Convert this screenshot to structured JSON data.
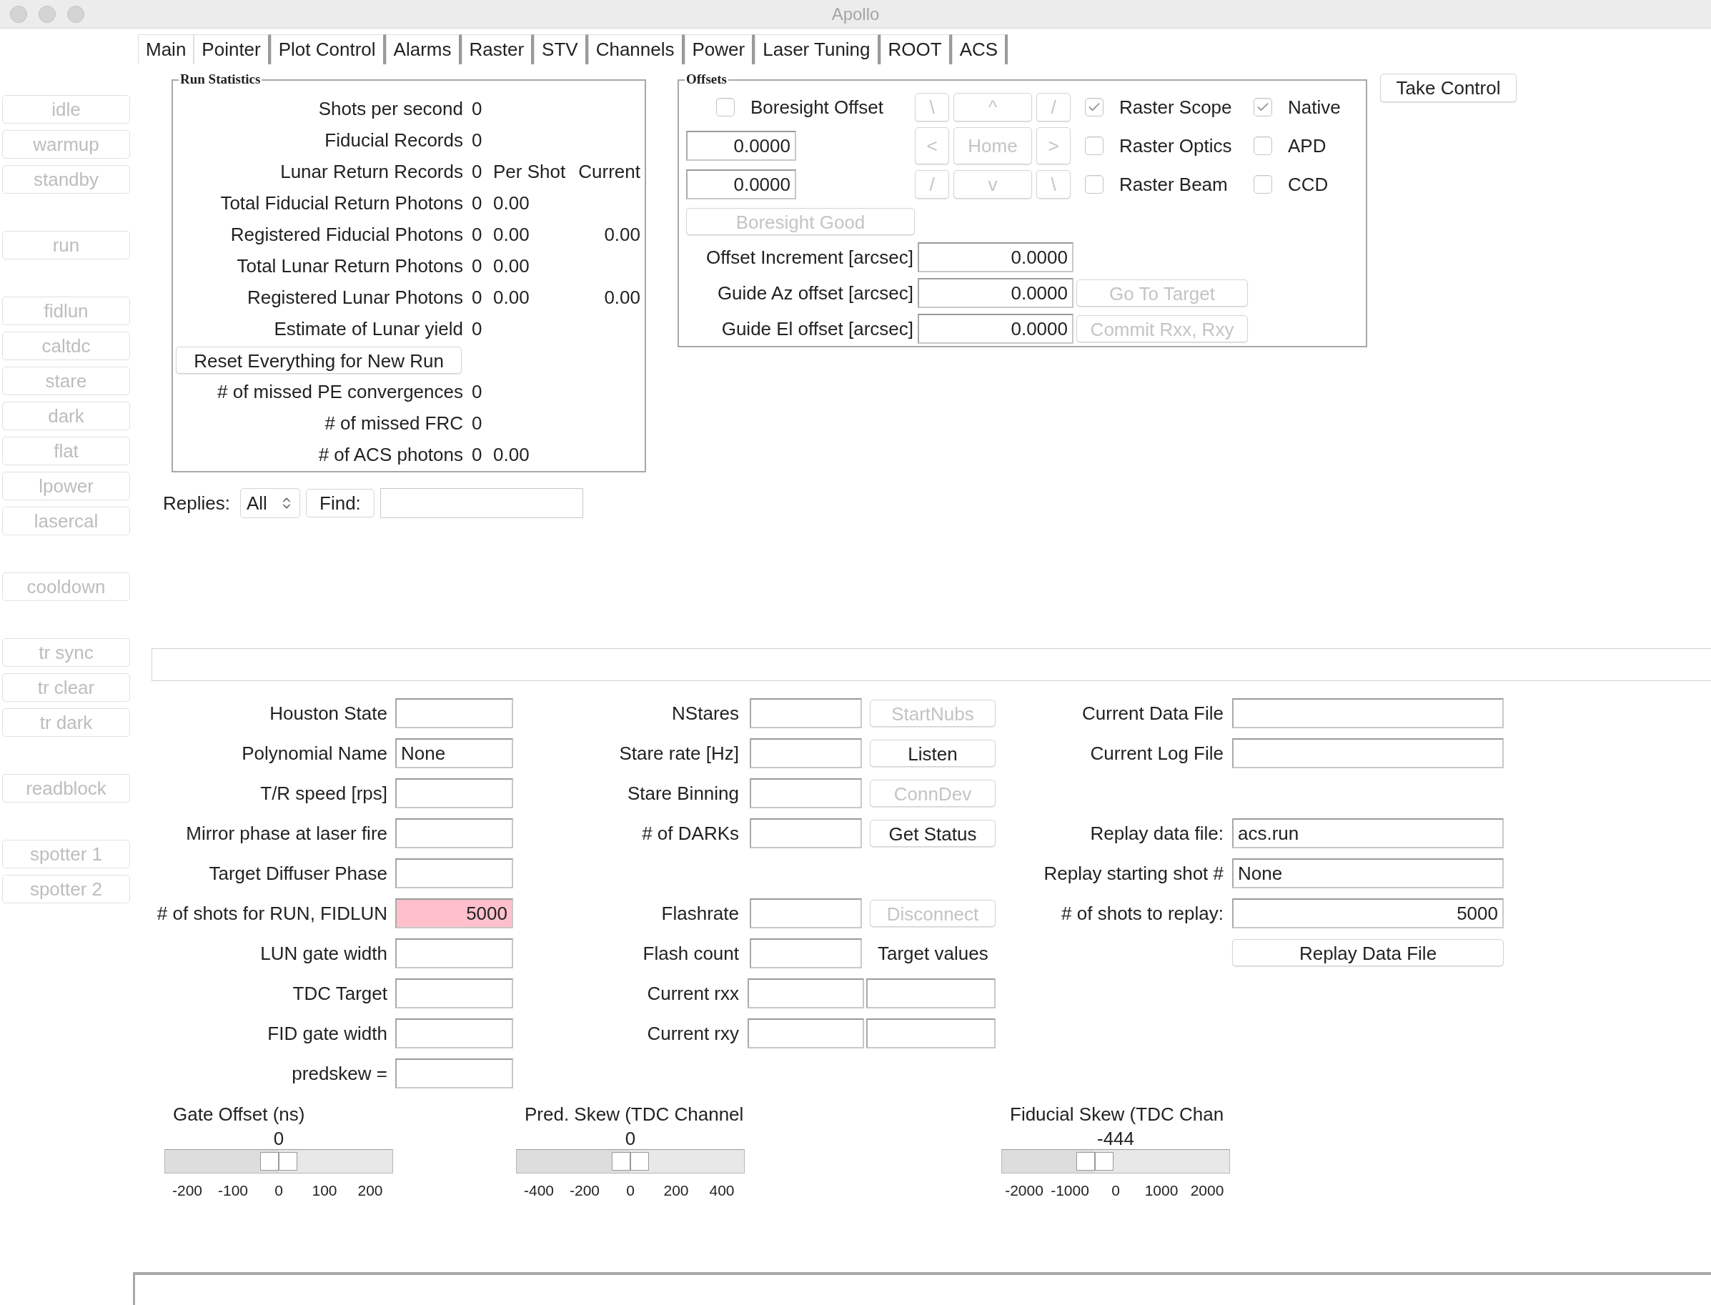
{
  "window": {
    "title": "Apollo"
  },
  "tabs": [
    {
      "label": "Main",
      "selected": true
    },
    {
      "label": "Pointer",
      "selected": false
    },
    {
      "label": "Plot Control",
      "selected": false
    },
    {
      "label": "Alarms",
      "selected": false
    },
    {
      "label": "Raster",
      "selected": false
    },
    {
      "label": "STV",
      "selected": false
    },
    {
      "label": "Channels",
      "selected": false
    },
    {
      "label": "Power",
      "selected": false
    },
    {
      "label": "Laser Tuning",
      "selected": false
    },
    {
      "label": "ROOT",
      "selected": false
    },
    {
      "label": "ACS",
      "selected": false
    }
  ],
  "sidebar": {
    "groups": [
      [
        {
          "label": "idle",
          "disabled": true
        },
        {
          "label": "warmup",
          "disabled": true
        },
        {
          "label": "standby",
          "disabled": true
        }
      ],
      [
        {
          "label": "run",
          "disabled": true
        }
      ],
      [
        {
          "label": "fidlun",
          "disabled": true
        },
        {
          "label": "caltdc",
          "disabled": true
        },
        {
          "label": "stare",
          "disabled": true
        },
        {
          "label": "dark",
          "disabled": true
        },
        {
          "label": "flat",
          "disabled": true
        },
        {
          "label": "lpower",
          "disabled": true
        },
        {
          "label": "lasercal",
          "disabled": true
        }
      ],
      [
        {
          "label": "cooldown",
          "disabled": true
        }
      ],
      [
        {
          "label": "tr sync",
          "disabled": true
        },
        {
          "label": "tr clear",
          "disabled": true
        },
        {
          "label": "tr dark",
          "disabled": true
        }
      ],
      [
        {
          "label": "readblock",
          "disabled": true
        }
      ],
      [
        {
          "label": "spotter 1",
          "disabled": true
        },
        {
          "label": "spotter 2",
          "disabled": true
        }
      ]
    ]
  },
  "run_statistics": {
    "title": "Run Statistics",
    "rows": [
      {
        "kind": "stat",
        "label": "Shots per second",
        "value": "0"
      },
      {
        "kind": "stat",
        "label": "Fiducial Records",
        "value": "0"
      },
      {
        "kind": "stat",
        "label": "Lunar Return Records",
        "value": "0",
        "per_shot": "Per Shot",
        "current": "Current"
      },
      {
        "kind": "stat",
        "label": "Total Fiducial Return Photons",
        "value": "0",
        "per_shot": "0.00"
      },
      {
        "kind": "stat",
        "label": "Registered Fiducial Photons",
        "value": "0",
        "per_shot": "0.00",
        "current": "0.00"
      },
      {
        "kind": "stat",
        "label": "Total Lunar Return Photons",
        "value": "0",
        "per_shot": "0.00"
      },
      {
        "kind": "stat",
        "label": "Registered Lunar Photons",
        "value": "0",
        "per_shot": "0.00",
        "current": "0.00"
      },
      {
        "kind": "stat",
        "label": "Estimate of Lunar yield",
        "value": "0"
      },
      {
        "kind": "button",
        "label": "Reset Everything for New Run"
      },
      {
        "kind": "stat",
        "label": "# of missed PE convergences",
        "value": "0"
      },
      {
        "kind": "stat",
        "label": "# of missed FRC",
        "value": "0"
      },
      {
        "kind": "stat",
        "label": "# of ACS photons",
        "value": "0",
        "per_shot": "0.00"
      }
    ]
  },
  "offsets": {
    "title": "Offsets",
    "boresight_offset": {
      "label": "Boresight Offset",
      "checked": false
    },
    "fields": [
      "0.0000",
      "0.0000"
    ],
    "nav": [
      {
        "label": "\\",
        "disabled": true
      },
      {
        "label": "^",
        "disabled": true
      },
      {
        "label": "/",
        "disabled": true
      },
      {
        "label": "<",
        "disabled": true
      },
      {
        "label": "Home",
        "disabled": true
      },
      {
        "label": ">",
        "disabled": true
      },
      {
        "label": "/",
        "disabled": true
      },
      {
        "label": "v",
        "disabled": true
      },
      {
        "label": "\\",
        "disabled": true
      }
    ],
    "checks": [
      {
        "label": "Raster Scope",
        "checked": true
      },
      {
        "label": "Native",
        "checked": true
      },
      {
        "label": "Raster Optics",
        "checked": false
      },
      {
        "label": "APD",
        "checked": false
      },
      {
        "label": "Raster Beam",
        "checked": false
      },
      {
        "label": "CCD",
        "checked": false
      }
    ],
    "boresight_good": {
      "label": "Boresight Good",
      "disabled": true
    },
    "rows": [
      {
        "label": "Offset Increment [arcsec]",
        "value": "0.0000"
      },
      {
        "label": "Guide Az offset [arcsec]",
        "value": "0.0000",
        "button": {
          "label": "Go To Target",
          "disabled": true
        }
      },
      {
        "label": "Guide El offset [arcsec]",
        "value": "0.0000",
        "button": {
          "label": "Commit Rxx, Rxy",
          "disabled": true
        }
      }
    ]
  },
  "take_control": {
    "label": "Take Control"
  },
  "replies": {
    "label": "Replies:",
    "select": "All",
    "find_button": "Find:"
  },
  "form": {
    "rows": [
      {
        "left": {
          "label": "Houston State",
          "highlighted": false
        },
        "middle": {
          "kind": "field",
          "label": "NStares",
          "button": {
            "label": "StartNubs",
            "disabled": true
          }
        },
        "right": {
          "kind": "field",
          "label": "Current Data File"
        }
      },
      {
        "left": {
          "label": "Polynomial Name",
          "value": "None",
          "highlighted": false
        },
        "middle": {
          "kind": "field",
          "label": "Stare rate [Hz]",
          "button": {
            "label": "Listen",
            "disabled": false
          }
        },
        "right": {
          "kind": "field",
          "label": "Current Log File"
        }
      },
      {
        "left": {
          "label": "T/R speed [rps]",
          "highlighted": false
        },
        "middle": {
          "kind": "field",
          "label": "Stare Binning",
          "button": {
            "label": "ConnDev",
            "disabled": true
          }
        }
      },
      {
        "left": {
          "label": "Mirror phase at laser fire",
          "highlighted": false
        },
        "middle": {
          "kind": "field",
          "label": "# of DARKs",
          "button": {
            "label": "Get Status",
            "disabled": false
          }
        },
        "right": {
          "kind": "field",
          "label": "Replay data file:",
          "value": "acs.run"
        }
      },
      {
        "left": {
          "label": "Target Diffuser Phase",
          "highlighted": false
        },
        "right": {
          "kind": "field",
          "label": "Replay starting shot #",
          "value": "None"
        }
      },
      {
        "left": {
          "label": "# of shots for RUN, FIDLUN",
          "value": "5000",
          "highlighted": true
        },
        "middle": {
          "kind": "field",
          "label": "Flashrate",
          "button": {
            "label": "Disconnect",
            "disabled": true
          }
        },
        "right": {
          "kind": "number_field",
          "label": "# of shots to replay:",
          "value": "5000"
        }
      },
      {
        "left": {
          "label": "LUN gate width",
          "highlighted": false
        },
        "middle": {
          "kind": "field",
          "label": "Flash count",
          "note": "Target values"
        },
        "right": {
          "kind": "button",
          "label": "Replay Data File"
        }
      },
      {
        "left": {
          "label": "TDC Target",
          "highlighted": false
        },
        "middle": {
          "kind": "pair",
          "label": "Current rxx"
        }
      },
      {
        "left": {
          "label": "FID gate width",
          "highlighted": false
        },
        "middle": {
          "kind": "pair",
          "label": "Current rxy"
        }
      },
      {
        "left": {
          "label": "predskew =",
          "highlighted": false
        }
      }
    ]
  },
  "sliders": [
    {
      "title": "Gate Offset (ns)",
      "value": "0",
      "level": 0.5,
      "ticks": [
        "-200",
        "-100",
        "0",
        "100",
        "200"
      ]
    },
    {
      "title": "Pred. Skew (TDC Channel",
      "value": "0",
      "level": 0.5,
      "ticks": [
        "-400",
        "-200",
        "0",
        "200",
        "400"
      ]
    },
    {
      "title": "Fiducial Skew (TDC Chan",
      "value": "-444",
      "level": 0.41,
      "ticks": [
        "-2000",
        "-1000",
        "0",
        "1000",
        "2000"
      ]
    }
  ]
}
